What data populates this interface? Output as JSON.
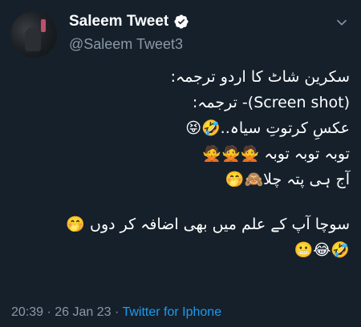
{
  "header": {
    "display_name": "Saleem Tweet",
    "handle": "@Saleem Tweet3"
  },
  "tweet": {
    "lines": [
      "سکرین شاٹ کا اردو ترجمہ:",
      "(Screen shot)- ترجمہ:",
      "عکسِ کرتوتِ سیاہ..🤣😝",
      "توبہ توبہ توبہ 🙅🙅🙅",
      "آج ہی پتہ چلا🙈🤭",
      "",
      "سوچا آپ کے علم میں بھی اضافہ کر دوں 🤭",
      "🤣😂😬"
    ]
  },
  "meta": {
    "time": "20:39",
    "date": "26 Jan 23",
    "separator": " · ",
    "source": "Twitter for Iphone"
  },
  "colors": {
    "background": "#15202b",
    "secondary_text": "#8b98a5",
    "link": "#1d9bf0"
  },
  "icons": {
    "verified": "verified-badge-icon",
    "more": "more-options-icon"
  }
}
